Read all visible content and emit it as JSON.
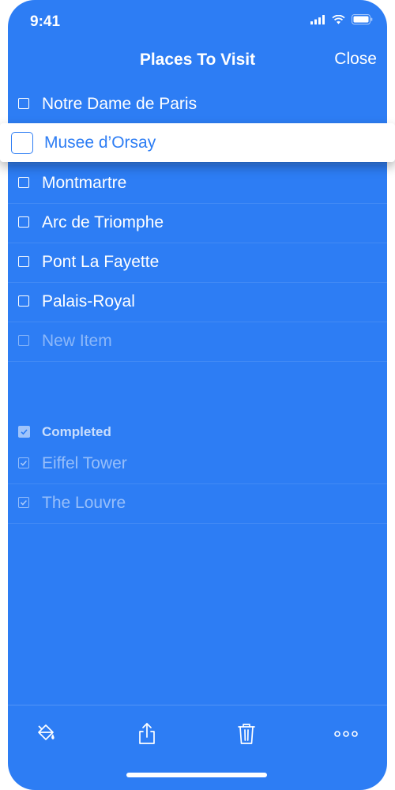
{
  "status": {
    "time": "9:41",
    "icons": [
      "cellular-signal-icon",
      "wifi-icon",
      "battery-icon"
    ]
  },
  "nav": {
    "title": "Places To Visit",
    "close_label": "Close"
  },
  "dragging_item": {
    "label": "Musee d’Orsay"
  },
  "items": [
    {
      "label": "Notre Dame de Paris"
    },
    {
      "label": ""
    },
    {
      "label": "Montmartre"
    },
    {
      "label": "Arc de Triomphe"
    },
    {
      "label": "Pont La Fayette"
    },
    {
      "label": "Palais-Royal"
    }
  ],
  "new_item": {
    "placeholder": "New Item"
  },
  "completed": {
    "header": "Completed",
    "items": [
      {
        "label": "Eiffel Tower"
      },
      {
        "label": "The Louvre"
      }
    ]
  },
  "toolbar": {
    "icons": [
      "paint-bucket-icon",
      "share-icon",
      "trash-icon",
      "more-icon"
    ]
  },
  "colors": {
    "background": "#2d7df4",
    "text": "#ffffff"
  }
}
